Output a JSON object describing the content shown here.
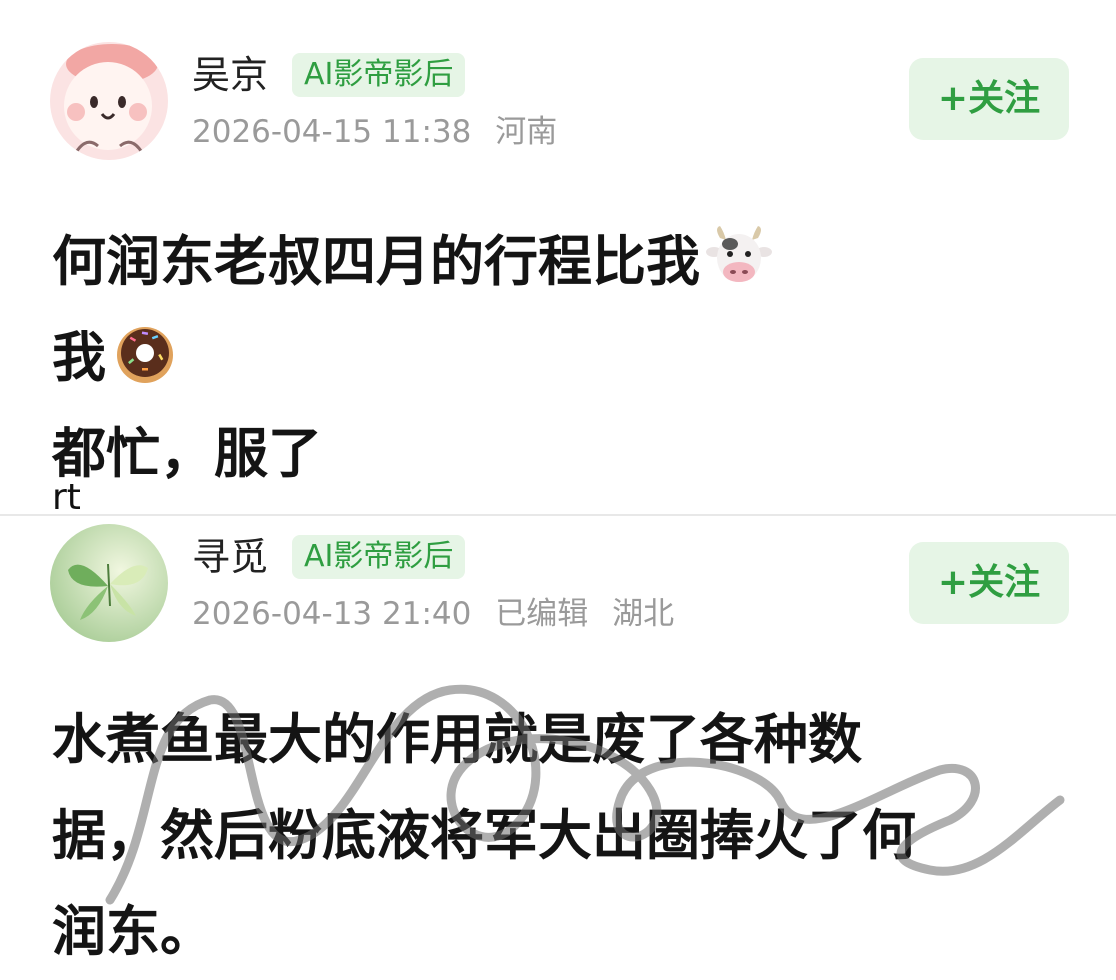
{
  "posts": [
    {
      "username": "吴京",
      "badge": "AI影帝影后",
      "timestamp": "2026-04-15 11:38",
      "edited_label": "",
      "location": "河南",
      "follow_label": "+关注",
      "content_lines": [
        "何润东老叔四月的行程比我",
        "我",
        "都忙，服了"
      ],
      "emojis": [
        "cow-face-icon",
        "doughnut-icon"
      ],
      "footer_text": "rt"
    },
    {
      "username": "寻觅",
      "badge": "AI影帝影后",
      "timestamp": "2026-04-13 21:40",
      "edited_label": "已编辑",
      "location": "湖北",
      "follow_label": "+关注",
      "content_lines": [
        "水煮鱼最大的作用就是废了各种数",
        "据，然后粉底液将军大出圈捧火了何",
        "润东。"
      ]
    }
  ],
  "colors": {
    "accent_green": "#2f9e41",
    "badge_background": "#e6f5e6",
    "meta_gray": "#9a9a9a"
  }
}
